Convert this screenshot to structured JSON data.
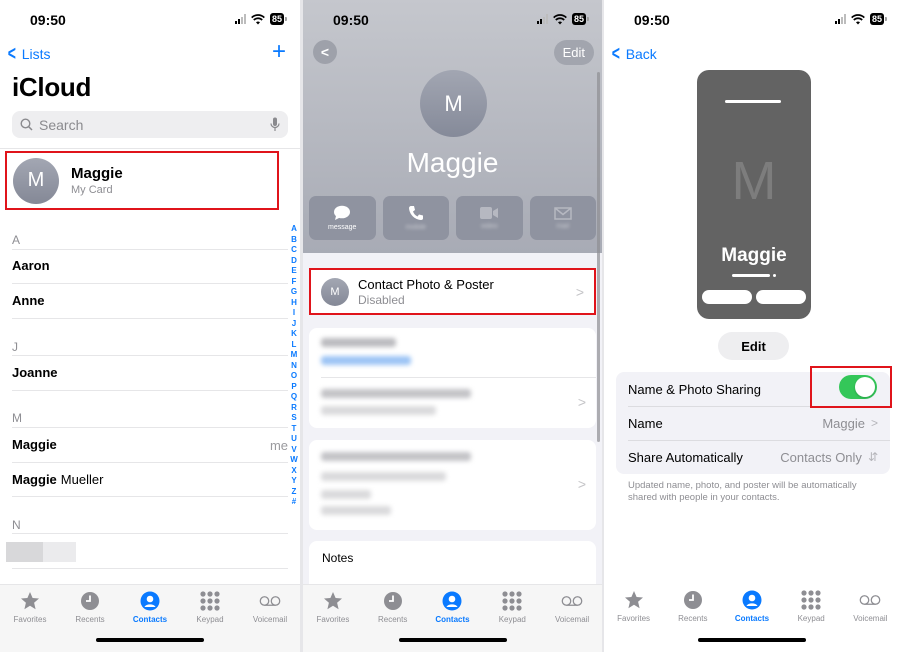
{
  "status_bar": {
    "time": "09:50",
    "battery": "85"
  },
  "panel1": {
    "nav": {
      "back_label": "Lists",
      "add_icon": "plus-icon"
    },
    "title": "iCloud",
    "search": {
      "placeholder": "Search"
    },
    "my_card": {
      "initial": "M",
      "name": "Maggie",
      "subtitle": "My Card"
    },
    "sections": [
      {
        "letter": "A",
        "contacts": [
          {
            "first": "Aaron",
            "last": ""
          },
          {
            "first": "Anne",
            "last": ""
          }
        ]
      },
      {
        "letter": "J",
        "contacts": [
          {
            "first": "Joanne",
            "last": ""
          }
        ]
      },
      {
        "letter": "M",
        "contacts": [
          {
            "first": "Maggie",
            "last": "",
            "tag": "me"
          },
          {
            "first": "Maggie",
            "last": "Mueller"
          }
        ]
      },
      {
        "letter": "N",
        "contacts": []
      }
    ],
    "index_letters": [
      "A",
      "B",
      "C",
      "D",
      "E",
      "F",
      "G",
      "H",
      "I",
      "J",
      "K",
      "L",
      "M",
      "N",
      "O",
      "P",
      "Q",
      "R",
      "S",
      "T",
      "U",
      "V",
      "W",
      "X",
      "Y",
      "Z",
      "#"
    ]
  },
  "panel2": {
    "edit_label": "Edit",
    "contact": {
      "initial": "M",
      "name": "Maggie"
    },
    "actions": [
      {
        "icon": "message-icon",
        "label": "message"
      },
      {
        "icon": "phone-icon",
        "label": "mobile"
      },
      {
        "icon": "video-icon",
        "label": "video"
      },
      {
        "icon": "mail-icon",
        "label": "mail"
      }
    ],
    "contact_photo": {
      "initial": "M",
      "title": "Contact Photo & Poster",
      "status": "Disabled"
    },
    "notes_label": "Notes"
  },
  "panel3": {
    "back_label": "Back",
    "poster": {
      "initial": "M",
      "name": "Maggie"
    },
    "edit_label": "Edit",
    "settings": [
      {
        "label": "Name & Photo Sharing",
        "type": "toggle",
        "on": true
      },
      {
        "label": "Name",
        "value": "Maggie",
        "type": "disclosure"
      },
      {
        "label": "Share Automatically",
        "value": "Contacts Only",
        "type": "popup"
      }
    ],
    "footnote": "Updated name, photo, and poster will be automatically shared with people in your contacts."
  },
  "tab_bar": {
    "tabs": [
      {
        "label": "Favorites",
        "icon": "star-icon"
      },
      {
        "label": "Recents",
        "icon": "clock-icon"
      },
      {
        "label": "Contacts",
        "icon": "person-circle-icon",
        "active": true
      },
      {
        "label": "Keypad",
        "icon": "keypad-icon"
      },
      {
        "label": "Voicemail",
        "icon": "voicemail-icon"
      }
    ]
  },
  "colors": {
    "accent": "#0a7aff",
    "highlight_box": "#e0141b",
    "toggle_on": "#34c759"
  }
}
